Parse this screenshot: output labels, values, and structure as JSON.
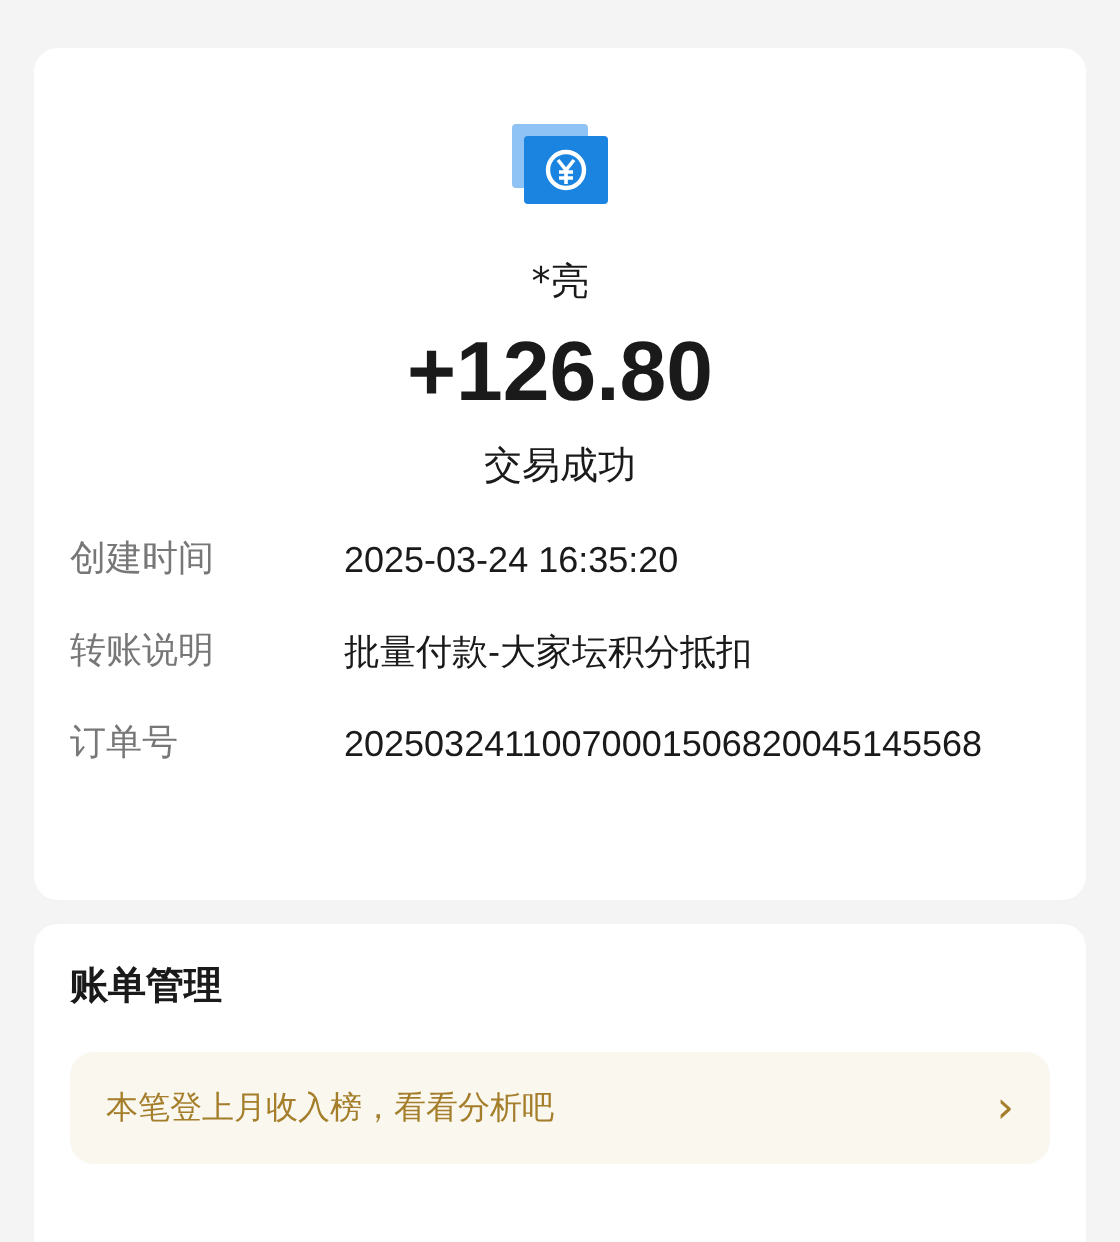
{
  "receipt": {
    "payer": "*亮",
    "amount": "+126.80",
    "status": "交易成功",
    "details": [
      {
        "label": "创建时间",
        "value": "2025-03-24 16:35:20"
      },
      {
        "label": "转账说明",
        "value": "批量付款-大家坛积分抵扣"
      },
      {
        "label": "订单号",
        "value": "20250324110070001506820045145568"
      }
    ]
  },
  "bill_management": {
    "title": "账单管理",
    "banner": {
      "text": "本笔登上月收入榜，看看分析吧",
      "chevron": "›"
    }
  }
}
